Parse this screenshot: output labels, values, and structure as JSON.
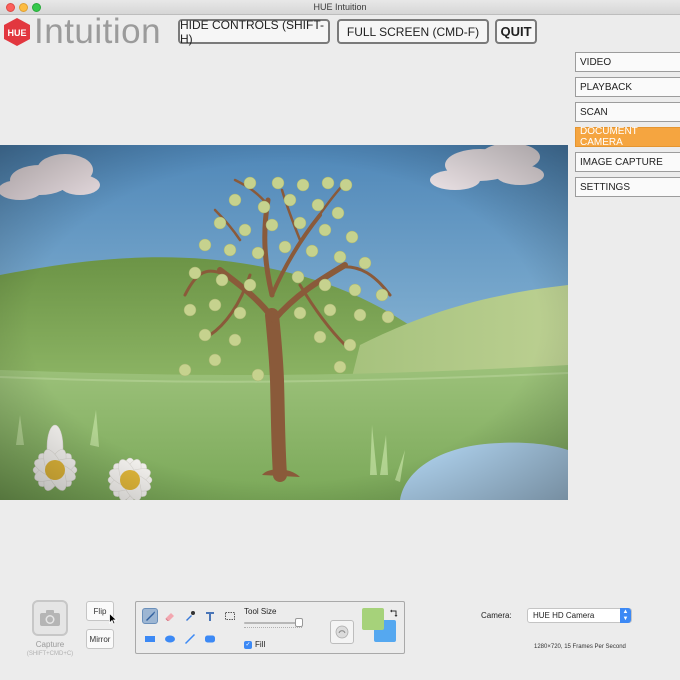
{
  "window": {
    "title": "HUE Intuition"
  },
  "logo": {
    "badge": "HUE",
    "text": "Intuition",
    "brand_color": "#e2373f"
  },
  "top_buttons": {
    "hide_controls": "HIDE CONTROLS (SHIFT-H)",
    "full_screen": "FULL SCREEN (CMD-F)",
    "quit": "QUIT"
  },
  "menu": {
    "items": [
      {
        "label": "VIDEO"
      },
      {
        "label": "PLAYBACK"
      },
      {
        "label": "SCAN"
      },
      {
        "label": "DOCUMENT CAMERA",
        "active": true
      },
      {
        "label": "IMAGE CAPTURE"
      },
      {
        "label": "SETTINGS"
      }
    ],
    "active_color": "#f5a540"
  },
  "toolbar": {
    "capture_label": "Capture",
    "capture_hint": "(SHIFT+CMD+C)",
    "flip_label": "Flip",
    "mirror_label": "Mirror",
    "tool_size_label": "Tool Size",
    "fill_label": "Fill",
    "fill_checked": true,
    "tool_size_level": 0.95,
    "foreground_color": "#a6d27a",
    "background_color": "#55a8f0",
    "tools": [
      "brush-icon",
      "eraser-icon",
      "eyedropper-icon",
      "text-icon",
      "marquee-select-icon",
      "rectangle-icon",
      "ellipse-icon",
      "line-icon",
      "rounded-rect-icon"
    ]
  },
  "camera": {
    "label": "Camera:",
    "selected": "HUE HD Camera",
    "resolution": "1280×720, 15 Frames Per Second"
  }
}
